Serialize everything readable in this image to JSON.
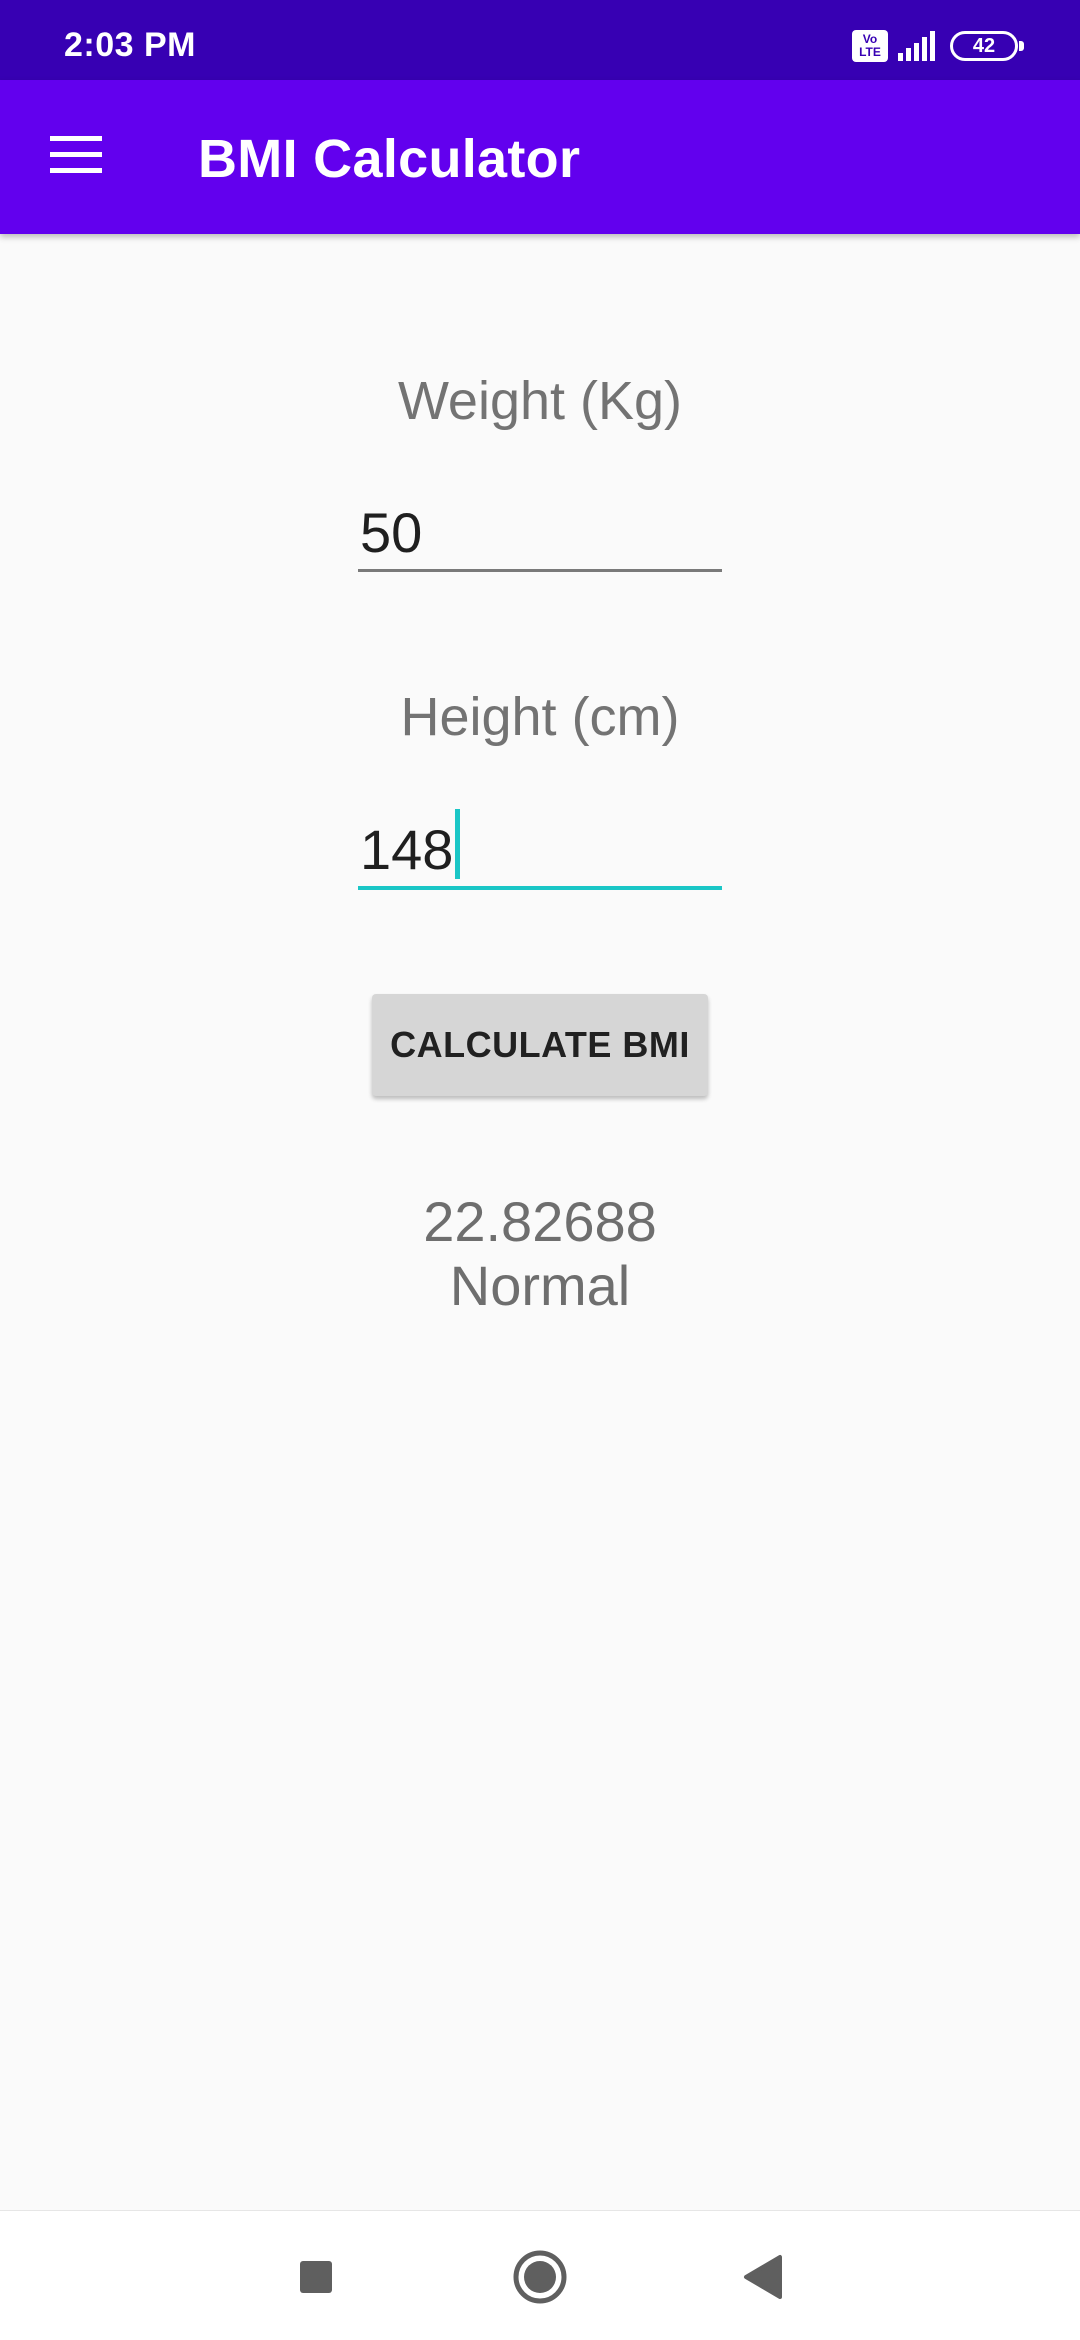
{
  "status_bar": {
    "time": "2:03 PM",
    "volte_label": "Vo LTE",
    "battery_level": "42"
  },
  "app_bar": {
    "title": "BMI Calculator",
    "menu_icon": "hamburger-menu-icon"
  },
  "form": {
    "weight_label": "Weight (Kg)",
    "weight_value": "50",
    "height_label": "Height (cm)",
    "height_value": "148",
    "button_label": "CALCULATE BMI"
  },
  "result": {
    "bmi_value": "22.82688",
    "category": "Normal"
  },
  "nav_bar": {
    "icons": [
      "recents-square-icon",
      "home-circle-icon",
      "back-triangle-icon"
    ]
  },
  "colors": {
    "status_bar": "#3700b3",
    "app_bar": "#6200ee",
    "focus_accent": "#1ac6c6",
    "background": "#fafafa"
  }
}
